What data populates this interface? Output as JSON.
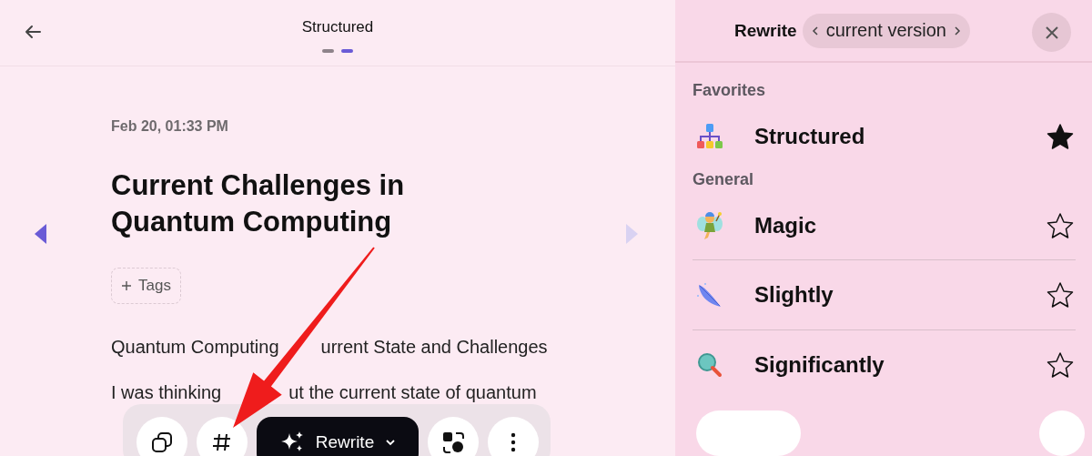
{
  "editor": {
    "title": "Structured",
    "pager": [
      {
        "selected": false
      },
      {
        "selected": true
      }
    ],
    "date": "Feb 20, 01:33 PM",
    "heading": "Current Challenges in Quantum Computing",
    "tags_button": "Tags",
    "paragraphs": [
      {
        "parts": [
          "Quantum Computing",
          "urrent State and Challenges"
        ]
      },
      {
        "parts": [
          "I was thinking",
          "ut the current state of quantum"
        ]
      }
    ]
  },
  "toolbar": {
    "rewrite_button": "Rewrite"
  },
  "rewrite_panel": {
    "title": "Rewrite",
    "version": "current version",
    "sections": [
      {
        "label": "Favorites",
        "items": [
          {
            "kind": "structured",
            "label": "Structured",
            "starred": true
          }
        ]
      },
      {
        "label": "General",
        "items": [
          {
            "kind": "magic",
            "label": "Magic",
            "starred": false
          },
          {
            "kind": "slightly",
            "label": "Slightly",
            "starred": false
          },
          {
            "kind": "significantly",
            "label": "Significantly",
            "starred": false
          }
        ]
      }
    ]
  }
}
